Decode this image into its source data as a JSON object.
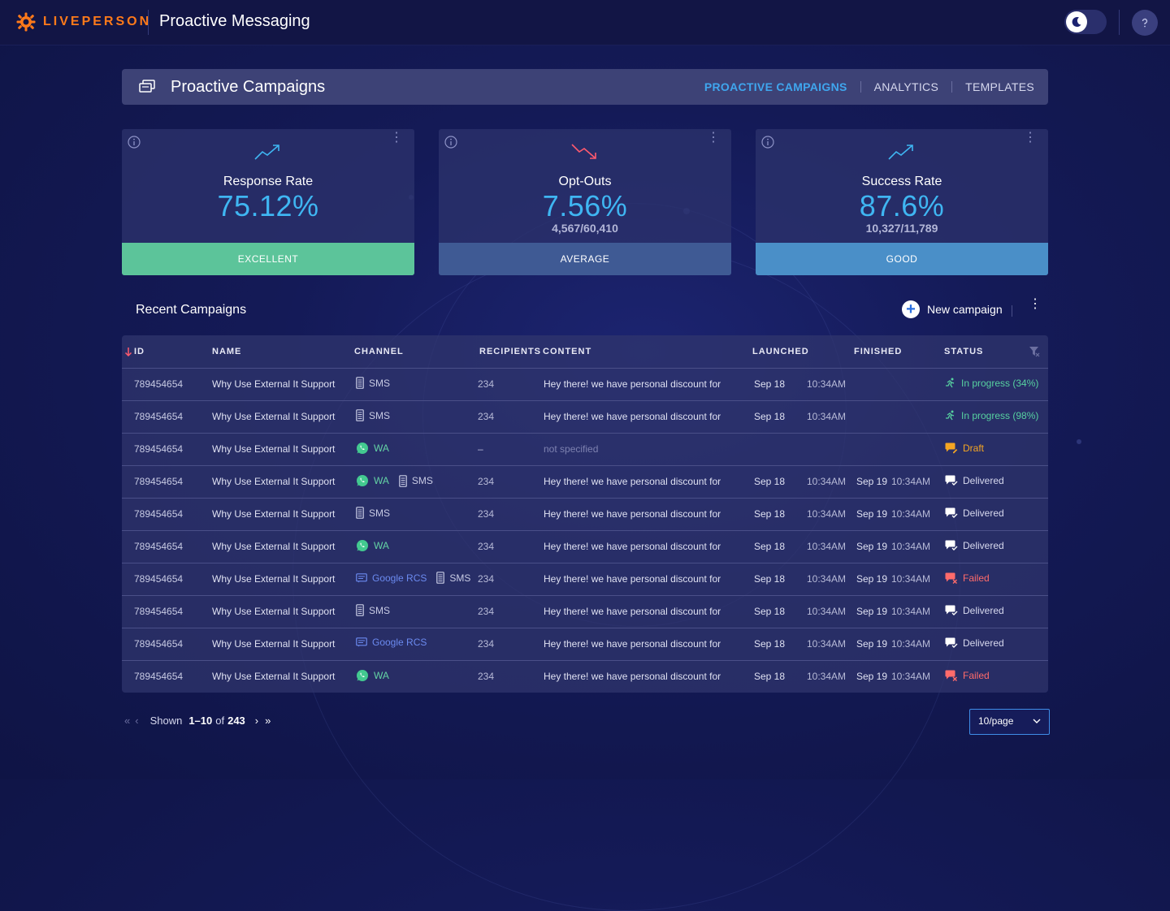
{
  "app": {
    "brand": "LIVEPERSON",
    "title": "Proactive Messaging"
  },
  "header": {
    "title": "Proactive Campaigns",
    "tabs": [
      {
        "label": "PROACTIVE CAMPAIGNS",
        "active": true
      },
      {
        "label": "ANALYTICS",
        "active": false
      },
      {
        "label": "TEMPLATES",
        "active": false
      }
    ]
  },
  "kpis": [
    {
      "label": "Response Rate",
      "value": "75.12%",
      "sub": "",
      "band": "EXCELLENT",
      "trend": "trend-up-icon",
      "band_color": "#5cc49a"
    },
    {
      "label": "Opt-Outs",
      "value": "7.56%",
      "sub": "4,567/60,410",
      "band": "AVERAGE",
      "trend": "trend-down-icon",
      "band_color": "#3f5a94"
    },
    {
      "label": "Success Rate",
      "value": "87.6%",
      "sub": "10,327/11,789",
      "band": "GOOD",
      "trend": "trend-up-icon",
      "band_color": "#4a8fc8"
    }
  ],
  "campaigns": {
    "title": "Recent Campaigns",
    "new_label": "New campaign",
    "columns": [
      "ID",
      "NAME",
      "CHANNEL",
      "RECIPIENTS",
      "CONTENT",
      "LAUNCHED",
      "FINISHED",
      "STATUS"
    ],
    "rows": [
      {
        "id": "789454654",
        "name": "Why Use External It Support",
        "channels": [
          "SMS"
        ],
        "recipients": "234",
        "content": "Hey there! we have personal discount for",
        "launched_date": "Sep 18",
        "launched_time": "10:34AM",
        "finished_date": "",
        "finished_time": "",
        "status": "In progress (34%)",
        "status_type": "progress"
      },
      {
        "id": "789454654",
        "name": "Why Use External It Support",
        "channels": [
          "SMS"
        ],
        "recipients": "234",
        "content": "Hey there! we have personal discount for",
        "launched_date": "Sep 18",
        "launched_time": "10:34AM",
        "finished_date": "",
        "finished_time": "",
        "status": "In progress (98%)",
        "status_type": "progress"
      },
      {
        "id": "789454654",
        "name": "Why Use External It Support",
        "channels": [
          "WA"
        ],
        "recipients": "–",
        "content": "not specified",
        "launched_date": "",
        "launched_time": "",
        "finished_date": "",
        "finished_time": "",
        "status": "Draft",
        "status_type": "draft"
      },
      {
        "id": "789454654",
        "name": "Why Use External It Support",
        "channels": [
          "WA",
          "SMS"
        ],
        "recipients": "234",
        "content": "Hey there! we have personal discount for",
        "launched_date": "Sep 18",
        "launched_time": "10:34AM",
        "finished_date": "Sep 19",
        "finished_time": "10:34AM",
        "status": "Delivered",
        "status_type": "delivered"
      },
      {
        "id": "789454654",
        "name": "Why Use External It Support",
        "channels": [
          "SMS"
        ],
        "recipients": "234",
        "content": "Hey there! we have personal discount for",
        "launched_date": "Sep 18",
        "launched_time": "10:34AM",
        "finished_date": "Sep 19",
        "finished_time": "10:34AM",
        "status": "Delivered",
        "status_type": "delivered"
      },
      {
        "id": "789454654",
        "name": "Why Use External It Support",
        "channels": [
          "WA"
        ],
        "recipients": "234",
        "content": "Hey there! we have personal discount for",
        "launched_date": "Sep 18",
        "launched_time": "10:34AM",
        "finished_date": "Sep 19",
        "finished_time": "10:34AM",
        "status": "Delivered",
        "status_type": "delivered"
      },
      {
        "id": "789454654",
        "name": "Why Use External It Support",
        "channels": [
          "Google RCS",
          "SMS"
        ],
        "recipients": "234",
        "content": "Hey there! we have personal discount for",
        "launched_date": "Sep 18",
        "launched_time": "10:34AM",
        "finished_date": "Sep 19",
        "finished_time": "10:34AM",
        "status": "Failed",
        "status_type": "failed"
      },
      {
        "id": "789454654",
        "name": "Why Use External It Support",
        "channels": [
          "SMS"
        ],
        "recipients": "234",
        "content": "Hey there! we have personal discount for",
        "launched_date": "Sep 18",
        "launched_time": "10:34AM",
        "finished_date": "Sep 19",
        "finished_time": "10:34AM",
        "status": "Delivered",
        "status_type": "delivered"
      },
      {
        "id": "789454654",
        "name": "Why Use External It Support",
        "channels": [
          "Google RCS"
        ],
        "recipients": "234",
        "content": "Hey there! we have personal discount for",
        "launched_date": "Sep 18",
        "launched_time": "10:34AM",
        "finished_date": "Sep 19",
        "finished_time": "10:34AM",
        "status": "Delivered",
        "status_type": "delivered"
      },
      {
        "id": "789454654",
        "name": "Why Use External It Support",
        "channels": [
          "WA"
        ],
        "recipients": "234",
        "content": "Hey there! we have personal discount for",
        "launched_date": "Sep 18",
        "launched_time": "10:34AM",
        "finished_date": "Sep 19",
        "finished_time": "10:34AM",
        "status": "Failed",
        "status_type": "failed"
      }
    ]
  },
  "pagination": {
    "shown_label": "Shown",
    "range": "1–10",
    "of_label": "of",
    "total": "243",
    "per_page": "10/page"
  },
  "colors": {
    "accent": "#3fa6ee",
    "brand": "#ff7a1a",
    "progress": "#57d1a0",
    "draft": "#f5a623",
    "failed": "#ff6b6b"
  }
}
